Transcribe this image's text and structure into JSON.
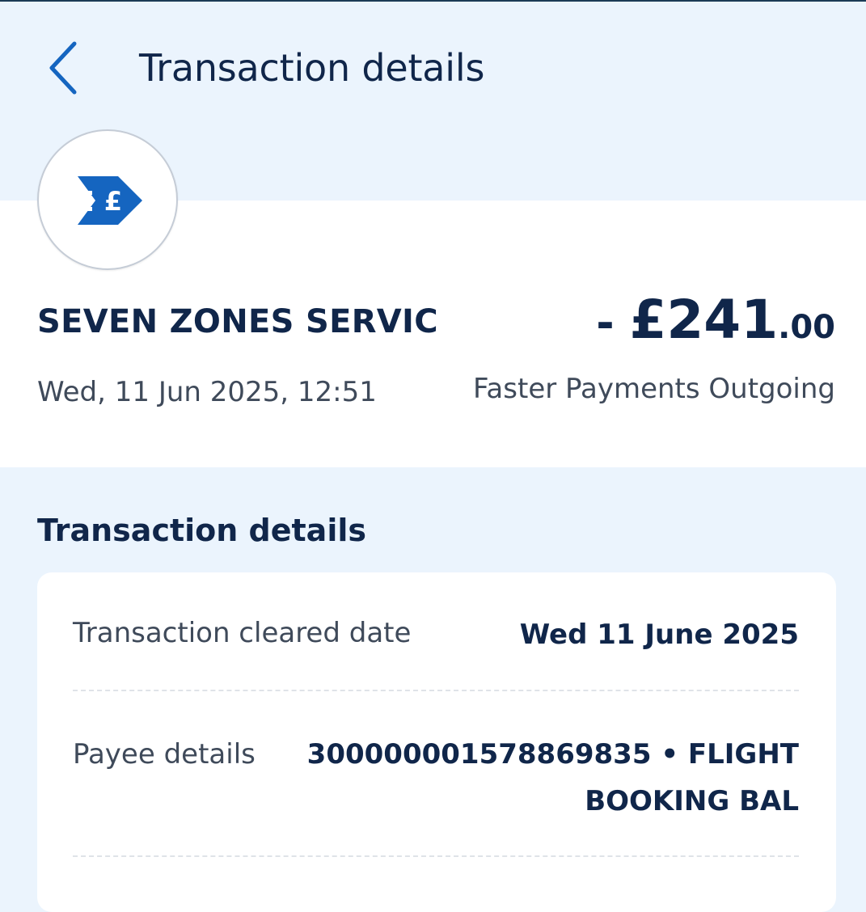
{
  "header": {
    "back_icon": "chevron-left-icon",
    "title": "Transaction details"
  },
  "summary": {
    "logo_icon": "faster-payment-pound-icon",
    "payee_name": "SEVEN ZONES SERVIC",
    "amount": {
      "sign": "- ",
      "major": "£241",
      "minor": ".00"
    },
    "datetime": "Wed, 11 Jun 2025, 12:51",
    "type": "Faster Payments Outgoing"
  },
  "details": {
    "section_title": "Transaction details",
    "rows": [
      {
        "label": "Transaction cleared date",
        "value": "Wed 11 June 2025"
      },
      {
        "label": "Payee details",
        "value_line1": "30000000157886983​5 • FLIGHT",
        "value_line2": "BOOKING BAL"
      }
    ]
  },
  "colors": {
    "background": "#ebf4fd",
    "text_primary": "#10264a",
    "text_secondary": "#3f4a5a",
    "accent": "#1565c0"
  }
}
